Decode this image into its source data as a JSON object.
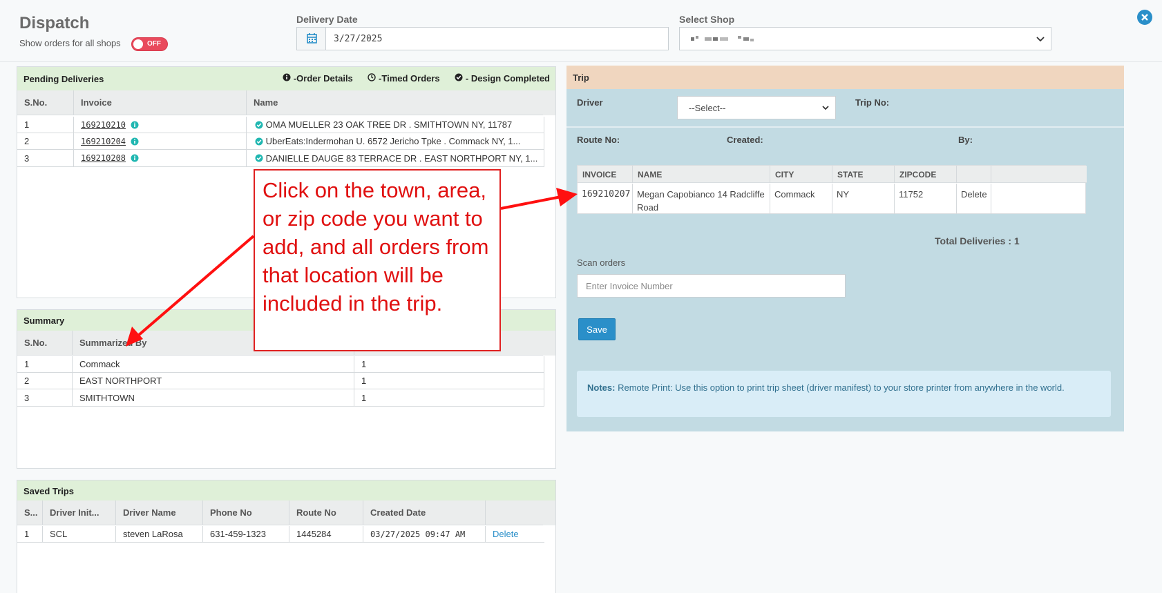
{
  "header": {
    "title": "Dispatch",
    "show_all_label": "Show orders for all shops",
    "toggle_label": "OFF",
    "delivery_date_label": "Delivery Date",
    "delivery_date_value": "3/27/2025",
    "select_shop_label": "Select Shop"
  },
  "pending": {
    "title": "Pending Deliveries",
    "legend": [
      "-Order Details",
      "-Timed Orders",
      "- Design Completed"
    ],
    "columns": [
      "S.No.",
      "Invoice",
      "Name"
    ],
    "rows": [
      {
        "sno": "1",
        "invoice": "169210210",
        "name": "OMA MUELLER 23 OAK TREE DR . SMITHTOWN NY, 11787"
      },
      {
        "sno": "2",
        "invoice": "169210204",
        "name": "UberEats:Indermohan U. 6572 Jericho Tpke . Commack NY, 1..."
      },
      {
        "sno": "3",
        "invoice": "169210208",
        "name": "DANIELLE DAUGE 83 TERRACE DR . EAST NORTHPORT NY, 1..."
      }
    ]
  },
  "summary": {
    "title": "Summary",
    "columns": [
      "S.No.",
      "Summarized By"
    ],
    "rows": [
      {
        "sno": "1",
        "by": "Commack",
        "count": "1"
      },
      {
        "sno": "2",
        "by": "EAST NORTHPORT",
        "count": "1"
      },
      {
        "sno": "3",
        "by": "SMITHTOWN",
        "count": "1"
      }
    ]
  },
  "saved_trips": {
    "title": "Saved Trips",
    "columns": [
      "S...",
      "Driver Init...",
      "Driver Name",
      "Phone No",
      "Route No",
      "Created Date"
    ],
    "rows": [
      {
        "sno": "1",
        "init": "SCL",
        "driver": "steven LaRosa",
        "phone": "631-459-1323",
        "route": "1445284",
        "created": "03/27/2025 09:47 AM",
        "action": "Delete"
      }
    ]
  },
  "trip": {
    "title": "Trip",
    "driver_label": "Driver",
    "driver_select": "--Select--",
    "trip_no_label": "Trip No:",
    "route_no_label": "Route No:",
    "created_label": "Created:",
    "by_label": "By:",
    "columns": [
      "INVOICE",
      "NAME",
      "CITY",
      "STATE",
      "ZIPCODE"
    ],
    "rows": [
      {
        "invoice": "169210207",
        "name": "Megan Capobianco 14 Radcliffe Road",
        "city": "Commack",
        "state": "NY",
        "zip": "11752",
        "action": "Delete"
      }
    ],
    "total": "Total Deliveries : 1",
    "scan_label": "Scan orders",
    "scan_placeholder": "Enter Invoice Number",
    "save_label": "Save",
    "notes_label": "Notes:",
    "notes_text": "Remote Print: Use this option to print trip sheet (driver manifest) to your store printer from anywhere in the world."
  },
  "callout": {
    "text": "Click on the town, area, or zip code you want to add, and all orders from that location will be included in the trip."
  },
  "colors": {
    "accent": "#2a8fc9",
    "panel_head_green": "#dff0d8",
    "trip_head": "#f0d6bf",
    "trip_body": "#c2dbe3",
    "toggle_off": "#e94a5c",
    "check_teal": "#20b7b1",
    "callout_red": "#e01010"
  }
}
